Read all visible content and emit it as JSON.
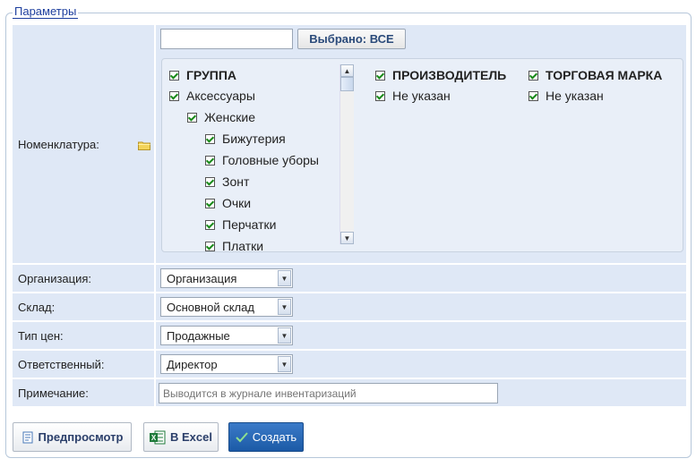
{
  "legend": "Параметры",
  "nomenclature": {
    "label": "Номенклатура:",
    "search_value": "",
    "selected_button": "Выбрано: ВСЕ",
    "tree": [
      {
        "label": "ГРУППА",
        "bold": true
      },
      {
        "label": "Аксессуары"
      },
      {
        "label": "Женские"
      },
      {
        "label": "Бижутерия"
      },
      {
        "label": "Головные уборы"
      },
      {
        "label": "Зонт"
      },
      {
        "label": "Очки"
      },
      {
        "label": "Перчатки"
      },
      {
        "label": "Платки"
      }
    ],
    "manufacturer": {
      "header": "ПРОИЗВОДИТЕЛЬ",
      "items": [
        "Не указан"
      ]
    },
    "brand": {
      "header": "ТОРГОВАЯ МАРКА",
      "items": [
        "Не указан"
      ]
    }
  },
  "fields": {
    "organization": {
      "label": "Организация:",
      "value": "Организация"
    },
    "warehouse": {
      "label": "Склад:",
      "value": "Основной склад"
    },
    "price_type": {
      "label": "Тип цен:",
      "value": "Продажные"
    },
    "responsible": {
      "label": "Ответственный:",
      "value": "Директор"
    },
    "note": {
      "label": "Примечание:",
      "placeholder": "Выводится в журнале инвентаризаций"
    }
  },
  "buttons": {
    "preview": "Предпросмотр",
    "excel": "В Excel",
    "create": "Создать"
  },
  "icons": {
    "folder": "folder-icon",
    "preview": "document-icon",
    "excel": "excel-icon",
    "create": "checkmark-icon",
    "scroll_up": "scroll-up-icon",
    "scroll_down": "scroll-down-icon",
    "dropdown": "chevron-down-icon"
  },
  "colors": {
    "label_bg": "#dfe8f6",
    "tree_bg": "#e9eff8",
    "legend": "#1d3e9e",
    "primary": "#1c5aa6",
    "check": "#1a8a1a"
  }
}
